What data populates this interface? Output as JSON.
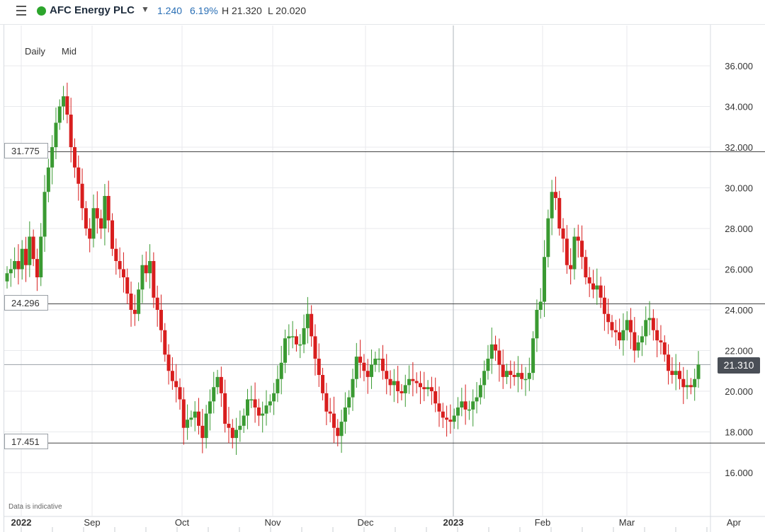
{
  "header": {
    "menu_icon": "hamburger-menu-icon",
    "status_color": "#2ca52c",
    "instrument_name": "AFC Energy PLC",
    "change": "1.240",
    "change_pct": "6.19%",
    "high": "H 21.320",
    "low": "L 20.020",
    "change_color": "#2a6fb5"
  },
  "timeframe": {
    "daily_label": "Daily",
    "mid_label": "Mid"
  },
  "disclaimer": "Data is indicative",
  "horizontal_lines": [
    {
      "value": 31.775,
      "label": "31.775"
    },
    {
      "value": 24.296,
      "label": "24.296"
    },
    {
      "value": 17.451,
      "label": "17.451"
    }
  ],
  "last_price": {
    "value": 21.31,
    "label": "21.310"
  },
  "colors": {
    "up": "#3a9a32",
    "down": "#d81e1e",
    "grid": "#e8eaed",
    "axis_text": "#333333"
  },
  "chart_data": {
    "type": "candlestick",
    "y_ticks": [
      "16.000",
      "18.000",
      "20.000",
      "22.000",
      "24.000",
      "26.000",
      "28.000",
      "30.000",
      "32.000",
      "34.000",
      "36.000"
    ],
    "x_labels": [
      "2022",
      "Sep",
      "Oct",
      "Nov",
      "Dec",
      "2023",
      "Feb",
      "Mar",
      "Apr"
    ],
    "ylim": [
      14.5,
      37.0
    ],
    "grid": true,
    "closes": [
      25.8,
      26.0,
      26.4,
      26.0,
      27.0,
      26.2,
      27.6,
      26.5,
      25.6,
      27.6,
      29.8,
      31.0,
      32.0,
      33.2,
      34.0,
      34.5,
      33.6,
      32.0,
      31.0,
      30.2,
      29.0,
      28.0,
      27.5,
      29.0,
      28.5,
      28.0,
      29.6,
      28.4,
      27.0,
      26.4,
      26.0,
      25.6,
      24.8,
      24.0,
      23.8,
      25.0,
      26.2,
      25.8,
      26.4,
      24.6,
      24.0,
      23.0,
      21.8,
      21.0,
      20.5,
      20.2,
      19.6,
      18.2,
      18.6,
      18.7,
      19.0,
      18.3,
      17.7,
      18.9,
      19.5,
      20.2,
      20.7,
      19.9,
      18.4,
      18.2,
      17.7,
      18.1,
      18.3,
      18.8,
      19.6,
      19.6,
      19.2,
      18.8,
      18.9,
      19.3,
      19.5,
      19.9,
      20.6,
      21.4,
      22.6,
      22.7,
      22.7,
      22.3,
      22.3,
      23.1,
      23.8,
      22.7,
      21.6,
      20.8,
      19.9,
      19.0,
      18.9,
      18.2,
      17.8,
      18.5,
      19.2,
      19.7,
      20.6,
      21.7,
      21.4,
      21.0,
      20.7,
      21.3,
      21.6,
      21.6,
      21.0,
      20.6,
      20.3,
      20.5,
      20.0,
      19.9,
      20.3,
      20.6,
      20.5,
      20.4,
      20.2,
      20.1,
      20.2,
      20.0,
      19.4,
      19.0,
      18.7,
      18.6,
      18.5,
      18.8,
      19.2,
      19.5,
      19.1,
      19.1,
      19.5,
      19.7,
      20.3,
      21.0,
      21.6,
      22.3,
      22.0,
      21.3,
      20.7,
      21.0,
      20.8,
      20.7,
      20.9,
      20.6,
      20.6,
      20.9,
      22.6,
      24.0,
      24.4,
      26.6,
      28.5,
      29.8,
      29.5,
      28.0,
      27.5,
      26.2,
      26.0,
      27.6,
      27.4,
      26.6,
      25.6,
      25.3,
      25.0,
      25.2,
      24.6,
      23.8,
      23.4,
      23.0,
      22.9,
      22.5,
      23.0,
      23.5,
      22.9,
      22.0,
      22.4,
      22.7,
      23.5,
      23.6,
      23.0,
      22.5,
      22.4,
      21.8,
      21.0,
      20.8,
      21.0,
      20.6,
      20.2,
      20.3,
      20.2,
      20.6,
      21.31
    ],
    "dates_note": ""
  }
}
